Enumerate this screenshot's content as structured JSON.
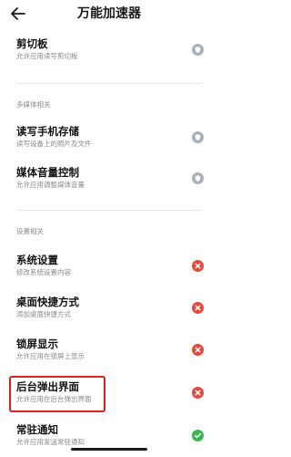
{
  "header": {
    "title": "万能加速器"
  },
  "rows": [
    {
      "title": "剪切板",
      "desc": "允许应用读写剪切板",
      "status": "gray"
    },
    {
      "title": "读写手机存储",
      "desc": "读写设备上的照片及文件",
      "status": "gray"
    },
    {
      "title": "媒体音量控制",
      "desc": "允许应用调整媒体音量",
      "status": "gray"
    },
    {
      "title": "系统设置",
      "desc": "修改系统设置内容",
      "status": "red"
    },
    {
      "title": "桌面快捷方式",
      "desc": "添加桌面快捷方式",
      "status": "red"
    },
    {
      "title": "锁屏显示",
      "desc": "允许应用在锁屏上显示",
      "status": "red"
    },
    {
      "title": "后台弹出界面",
      "desc": "允许应用在后台弹出界面",
      "status": "red"
    },
    {
      "title": "常驻通知",
      "desc": "允许应用发送常驻通知",
      "status": "green"
    }
  ],
  "sections": {
    "media": "多媒体相关",
    "settings": "设置相关"
  },
  "icons": {
    "back": "arrow-left-icon",
    "gray": "shield-icon",
    "red": "close-icon",
    "green": "check-icon"
  },
  "colors": {
    "status_gray": "#a9b1bc",
    "status_red": "#e8473a",
    "status_green": "#35b94c",
    "highlight": "#e01e1e"
  }
}
